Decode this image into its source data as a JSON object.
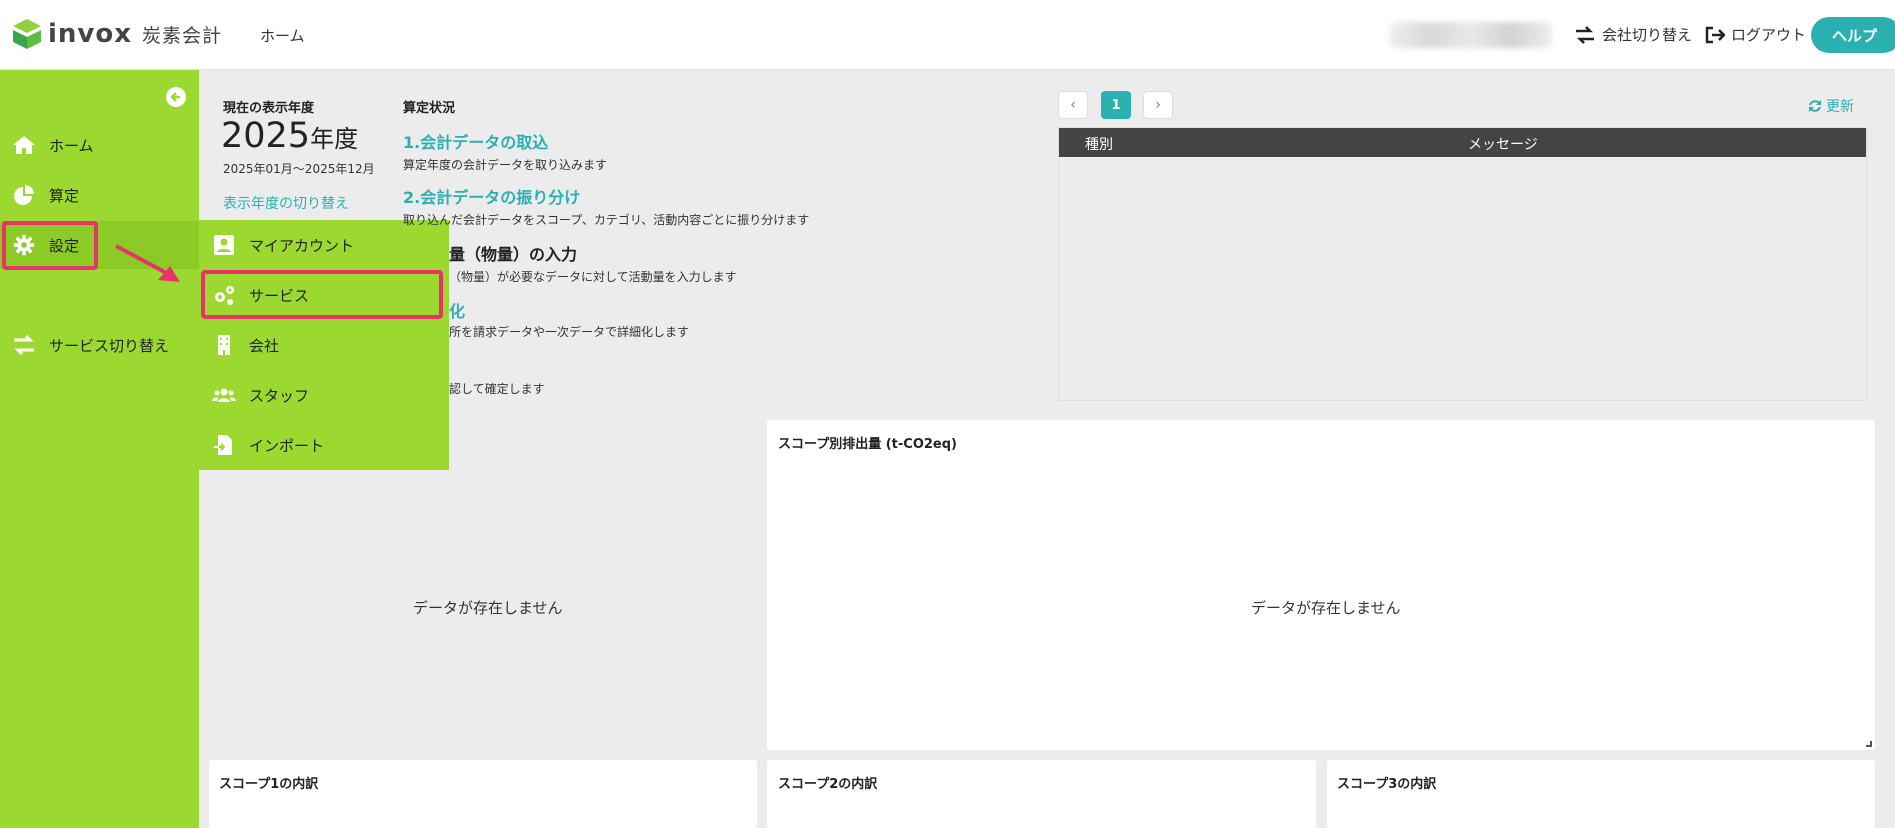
{
  "header": {
    "logo_text": "invox",
    "logo_sub": "炭素会計",
    "home_label": "ホーム",
    "switch_company": "会社切り替え",
    "logout": "ログアウト",
    "help": "ヘルプ"
  },
  "sidebar": {
    "items": [
      {
        "label": "ホーム",
        "icon": "home-icon"
      },
      {
        "label": "算定",
        "icon": "pie-chart-icon"
      },
      {
        "label": "設定",
        "icon": "gear-icon"
      },
      {
        "label": "サービス切り替え",
        "icon": "switch-icon"
      }
    ]
  },
  "flyout": {
    "items": [
      {
        "label": "マイアカウント",
        "icon": "account-card-icon"
      },
      {
        "label": "サービス",
        "icon": "cogs-icon"
      },
      {
        "label": "会社",
        "icon": "building-icon"
      },
      {
        "label": "スタッフ",
        "icon": "users-icon"
      },
      {
        "label": "インポート",
        "icon": "file-import-icon"
      }
    ]
  },
  "year_card": {
    "label": "現在の表示年度",
    "year": "2025",
    "year_unit": "年度",
    "range": "2025年01月～2025年12月",
    "switch_link": "表示年度の切り替え"
  },
  "status_card": {
    "title": "算定状況",
    "steps": [
      {
        "heading": "1.会計データの取込",
        "desc": "算定年度の会計データを取り込みます"
      },
      {
        "heading": "2.会計データの振り分け",
        "desc": "取り込んだ会計データをスコープ、カテゴリ、活動内容ごとに振り分けます"
      },
      {
        "heading": "量（物量）の入力",
        "desc": "（物量）が必要なデータに対して活動量を入力します"
      },
      {
        "heading": "化",
        "desc": "所を請求データや一次データで詳細化します"
      },
      {
        "heading": "",
        "desc": "認して確定します"
      }
    ]
  },
  "messages": {
    "page": "1",
    "refresh": "更新",
    "col_type": "種別",
    "col_message": "メッセージ"
  },
  "charts": {
    "scope_emissions_title": "スコープ別排出量 (t-CO2eq)",
    "no_data": "データが存在しません",
    "scope1": "スコープ1の内訳",
    "scope2": "スコープ2の内訳",
    "scope3": "スコープ3の内訳"
  },
  "colors": {
    "sidebar": "#9bd930",
    "accent": "#2ab0b0",
    "highlight": "#e8336a"
  }
}
